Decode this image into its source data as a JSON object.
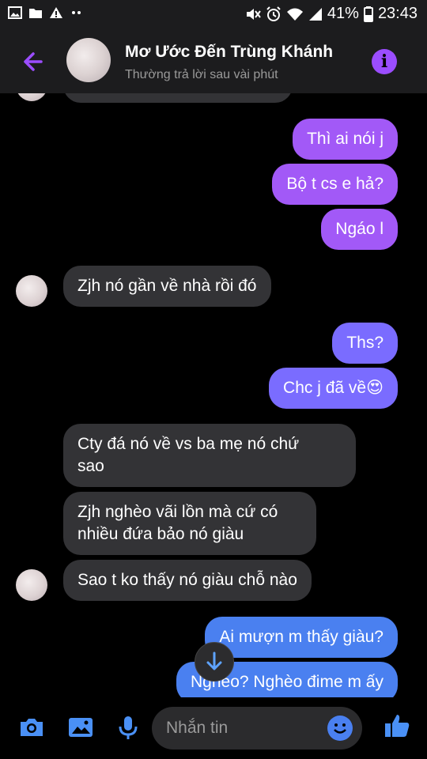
{
  "status_bar": {
    "battery": "41%",
    "time": "23:43"
  },
  "header": {
    "title": "Mơ Ước Đến Trùng Khánh",
    "subtitle": "Thường trả lời sau vài phút"
  },
  "messages": [
    {
      "side": "out",
      "text": "Thì ai nói j"
    },
    {
      "side": "out",
      "text": "Bộ t cs e hả?"
    },
    {
      "side": "out",
      "text": "Ngáo l"
    },
    {
      "side": "in",
      "text": "Zjh nó gần về nhà rồi đó"
    },
    {
      "side": "out",
      "text": "Ths?"
    },
    {
      "side": "out",
      "text": "Chc j đã về😍"
    },
    {
      "side": "in",
      "line1": "Cty đá nó về vs ba mẹ nó chứ",
      "line2": "sao"
    },
    {
      "side": "in",
      "line1": "Zjh nghèo vãi lồn mà cứ có",
      "line2": "nhiều đứa bảo nó giàu"
    },
    {
      "side": "in",
      "text": "Sao t ko thấy nó giàu chỗ nào"
    },
    {
      "side": "out",
      "text": "Ai mượn m thấy giàu?"
    },
    {
      "side": "out",
      "text": "Nghèo? Nghèo đime m ấy"
    }
  ],
  "composer": {
    "placeholder": "Nhắn tin"
  },
  "colors": {
    "accent": "#9b4dff",
    "bubble_in": "#333336",
    "bubble_out_top": "#a259f7",
    "bubble_out_bottom": "#4a80f0"
  },
  "icons": [
    "image-icon",
    "folder-icon",
    "warning-icon",
    "mute-icon",
    "alarm-icon",
    "wifi-icon",
    "signal-icon",
    "battery-icon",
    "back-arrow-icon",
    "info-icon",
    "scroll-down-icon",
    "camera-icon",
    "gallery-icon",
    "microphone-icon",
    "emoji-icon",
    "thumbs-up-icon"
  ]
}
